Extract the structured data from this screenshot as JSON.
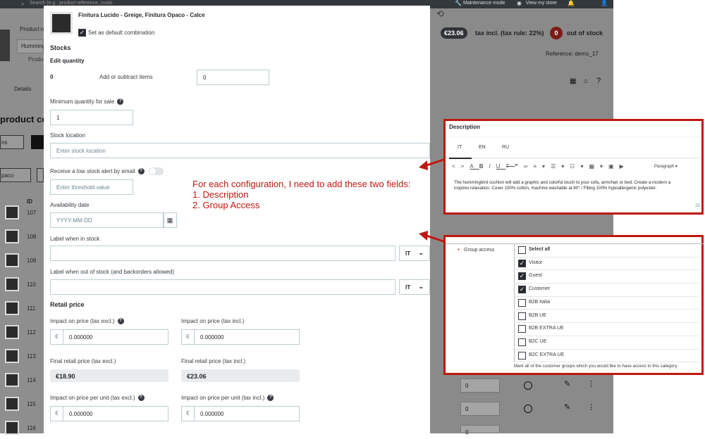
{
  "topbar": {
    "search_placeholder": "Search (e.g.: product reference, custo",
    "maintenance": "Maintenance mode",
    "view_store": "View my store"
  },
  "background": {
    "product_name_label": "Product n",
    "hum": "Humming",
    "produ": "Produ",
    "details_tab": "Details",
    "product_comb": "product com",
    "ns": "ns",
    "pa": "paco",
    "id_header": "ID",
    "ids": [
      "107",
      "108",
      "109",
      "110",
      "111",
      "112",
      "113",
      "114",
      "115",
      "116"
    ],
    "price_badge": "€23.06",
    "tax_label": "tax incl. (tax rule: 22%)",
    "stock_badge": "0",
    "stock_label": "out of stock",
    "reference": "Reference: demo_17",
    "row_qty": [
      "0",
      "0",
      "0"
    ]
  },
  "modal": {
    "title": "Finitura Lucido - Greige, Finitura Opaco - Calce",
    "default_label": "Set as default combination",
    "stocks_heading": "Stocks",
    "edit_quantity": "Edit quantity",
    "current_qty": "0",
    "add_subtract": "Add or subtract items",
    "add_value": "0",
    "min_qty_label": "Minimum quantity for sale",
    "min_qty_value": "1",
    "stock_location_label": "Stock location",
    "stock_location_placeholder": "Enter stock location",
    "low_stock_label": "Receive a low stock alert by email",
    "threshold_placeholder": "Enter threshold value",
    "availability_label": "Availability date",
    "date_placeholder": "YYYY-MM-DD",
    "label_in_stock": "Label when in stock",
    "label_out_stock": "Label when out of stock (and backorders allowed)",
    "lang": "IT",
    "retail_heading": "Retail price",
    "impact_excl": "Impact on price (tax excl.)",
    "impact_incl": "Impact on price (tax incl.)",
    "currency": "€",
    "zero": "0.000000",
    "final_excl_label": "Final retail price (tax excl.)",
    "final_excl": "€18.90",
    "final_incl_label": "Final retail price (tax incl.)",
    "final_incl": "€23.06",
    "unit_excl": "Impact on price per unit (tax excl.)",
    "unit_incl": "Impact on price per unit (tax incl.)"
  },
  "annotation": {
    "line1": "For each configuration, I need to add these two fields:",
    "line2": "1. Description",
    "line3": "2. Group Access"
  },
  "description_panel": {
    "heading": "Description",
    "tabs": [
      "IT",
      "EN",
      "RU"
    ],
    "paragraph": "Paragraph",
    "text1": "The hummingbird cushion will add a graphic and colorful touch to your sofa, armchair or bed. Create a modern a",
    "text2": "inspires relaxation. Cover 100% cotton, machine washable at 60° / Filling 100% hypoallergenic polyester.",
    "counter": "23"
  },
  "group_panel": {
    "label": "Group access",
    "required": "*",
    "groups": [
      {
        "name": "Select all",
        "checked": false,
        "bold": true
      },
      {
        "name": "Visitor",
        "checked": true
      },
      {
        "name": "Guest",
        "checked": true
      },
      {
        "name": "Customer",
        "checked": true
      },
      {
        "name": "B2B Italia",
        "checked": false
      },
      {
        "name": "B2B UE",
        "checked": false
      },
      {
        "name": "B2B EXTRA UE",
        "checked": false
      },
      {
        "name": "B2C UE",
        "checked": false
      },
      {
        "name": "B2C EXTRA UE",
        "checked": false
      }
    ],
    "hint": "Mark all of the customer groups which you would like to have access to this category."
  },
  "colors": {
    "accent": "#c0170f",
    "overlay": "#8a8a8a",
    "dark": "#25292e"
  }
}
